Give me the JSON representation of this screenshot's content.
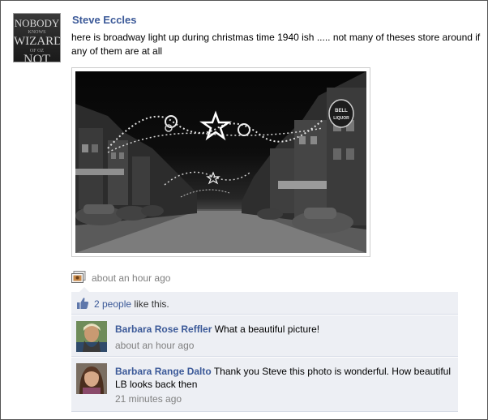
{
  "post": {
    "author": "Steve Eccles",
    "avatar_lines": [
      "NOBODY",
      "KNOWS",
      "WIZARD",
      "OF OZ",
      "NOT"
    ],
    "text": "here is broadway light up during christmas time 1940 ish ..... not many of theses store around if any of them are at all",
    "timestamp": "about an hour ago",
    "photo_sign_text": [
      "BELL",
      "LIQUOR"
    ]
  },
  "likes": {
    "count_link": "2 people",
    "suffix": " like this."
  },
  "comments": [
    {
      "name": "Barbara Rose Reffler",
      "text": "What a beautiful picture!",
      "time": "about an hour ago"
    },
    {
      "name": "Barbara Range Dalto",
      "text": "Thank you Steve this photo is wonderful. How beautiful LB looks back then",
      "time": "21 minutes ago"
    }
  ],
  "colors": {
    "link": "#3b5998",
    "muted": "#808080",
    "panel": "#edeff4"
  },
  "icons": {
    "photo": "photo-icon",
    "like": "thumbs-up-icon"
  }
}
